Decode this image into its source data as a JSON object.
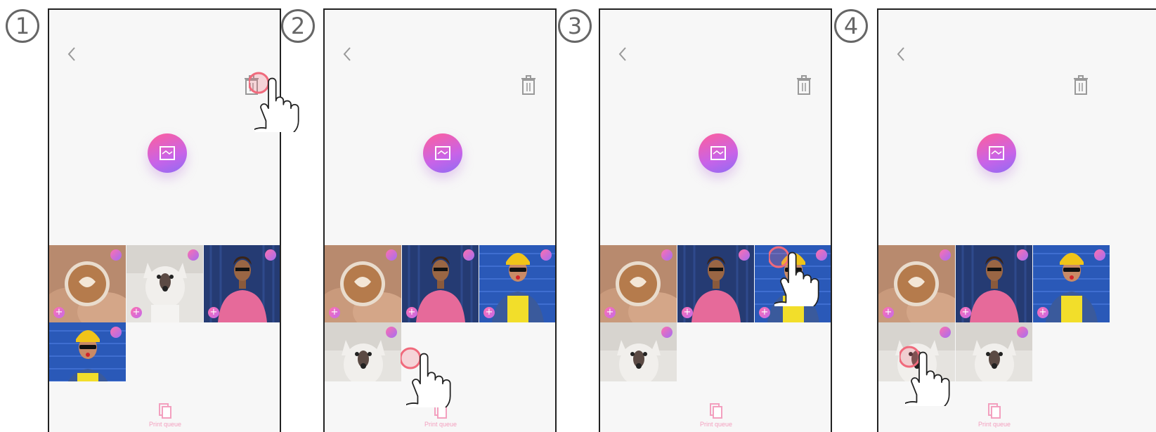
{
  "steps": [
    {
      "number": "1"
    },
    {
      "number": "2"
    },
    {
      "number": "3"
    },
    {
      "number": "4"
    }
  ],
  "icons": {
    "back": "chevron-left-icon",
    "trash": "trash-icon",
    "print": "print-icon",
    "queue": "print-queue-icon",
    "hand": "hand-pointer-icon"
  },
  "print_queue_label": "Print queue",
  "photo_labels": {
    "plus": "+"
  },
  "colors": {
    "accent_gradient_start": "#ff5f9b",
    "accent_gradient_end": "#8e6cf3",
    "tap_ring": "#f06a7c",
    "queue_label": "#f3a0bf"
  }
}
